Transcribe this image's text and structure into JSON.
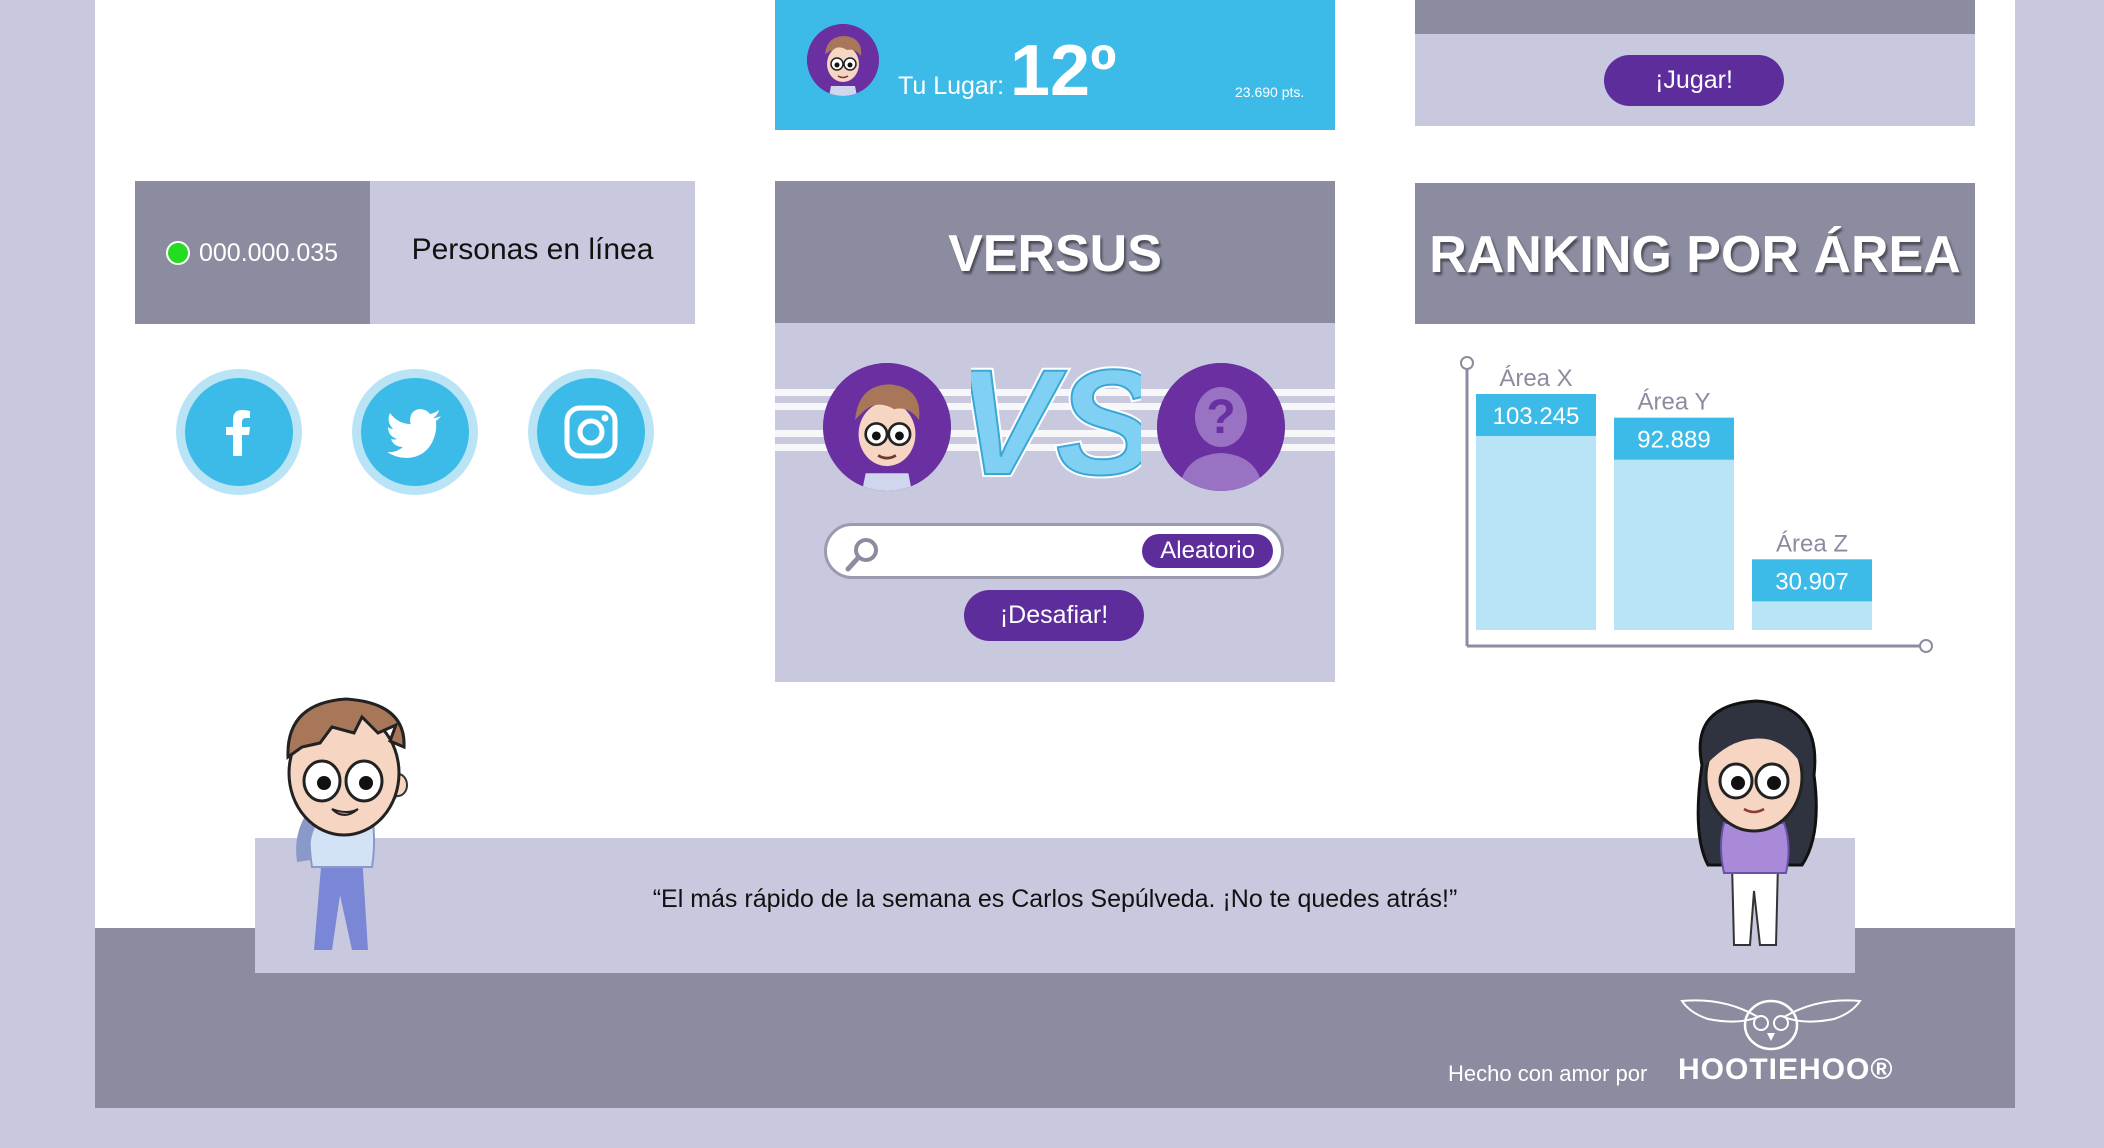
{
  "rank_card": {
    "place_label": "Tu Lugar:",
    "place_value": "12º",
    "points": "23.690 pts."
  },
  "jugar_card": {
    "button_label": "¡Jugar!"
  },
  "online": {
    "count": "000.000.035",
    "label": "Personas en línea",
    "status_color": "#22dd22"
  },
  "social": {
    "icons": [
      "facebook-icon",
      "twitter-icon",
      "instagram-icon"
    ]
  },
  "versus": {
    "title": "VERSUS",
    "logo_text": "VS",
    "search_placeholder": "",
    "random_button": "Aleatorio",
    "challenge_button": "¡Desafiar!"
  },
  "ranking": {
    "title": "RANKING POR ÁREA"
  },
  "chart_data": {
    "type": "bar",
    "categories": [
      "Área X",
      "Área Y",
      "Área Z"
    ],
    "values": [
      103245,
      92889,
      30907
    ],
    "value_labels": [
      "103.245",
      "92.889",
      "30.907"
    ],
    "ylim": [
      0,
      105000
    ],
    "grid": false
  },
  "quote": {
    "text": "“El más rápido de la semana es Carlos Sepúlveda. ¡No te quedes atrás!”"
  },
  "footer": {
    "made_with": "Hecho con amor por",
    "brand": "HOOTIEHOO®"
  },
  "colors": {
    "accent_blue": "#3dbbe8",
    "light_blue": "#b8e4f6",
    "purple": "#5e2d9c",
    "panel_gray": "#8c8ca0",
    "panel_lavender": "#c8c8de"
  }
}
